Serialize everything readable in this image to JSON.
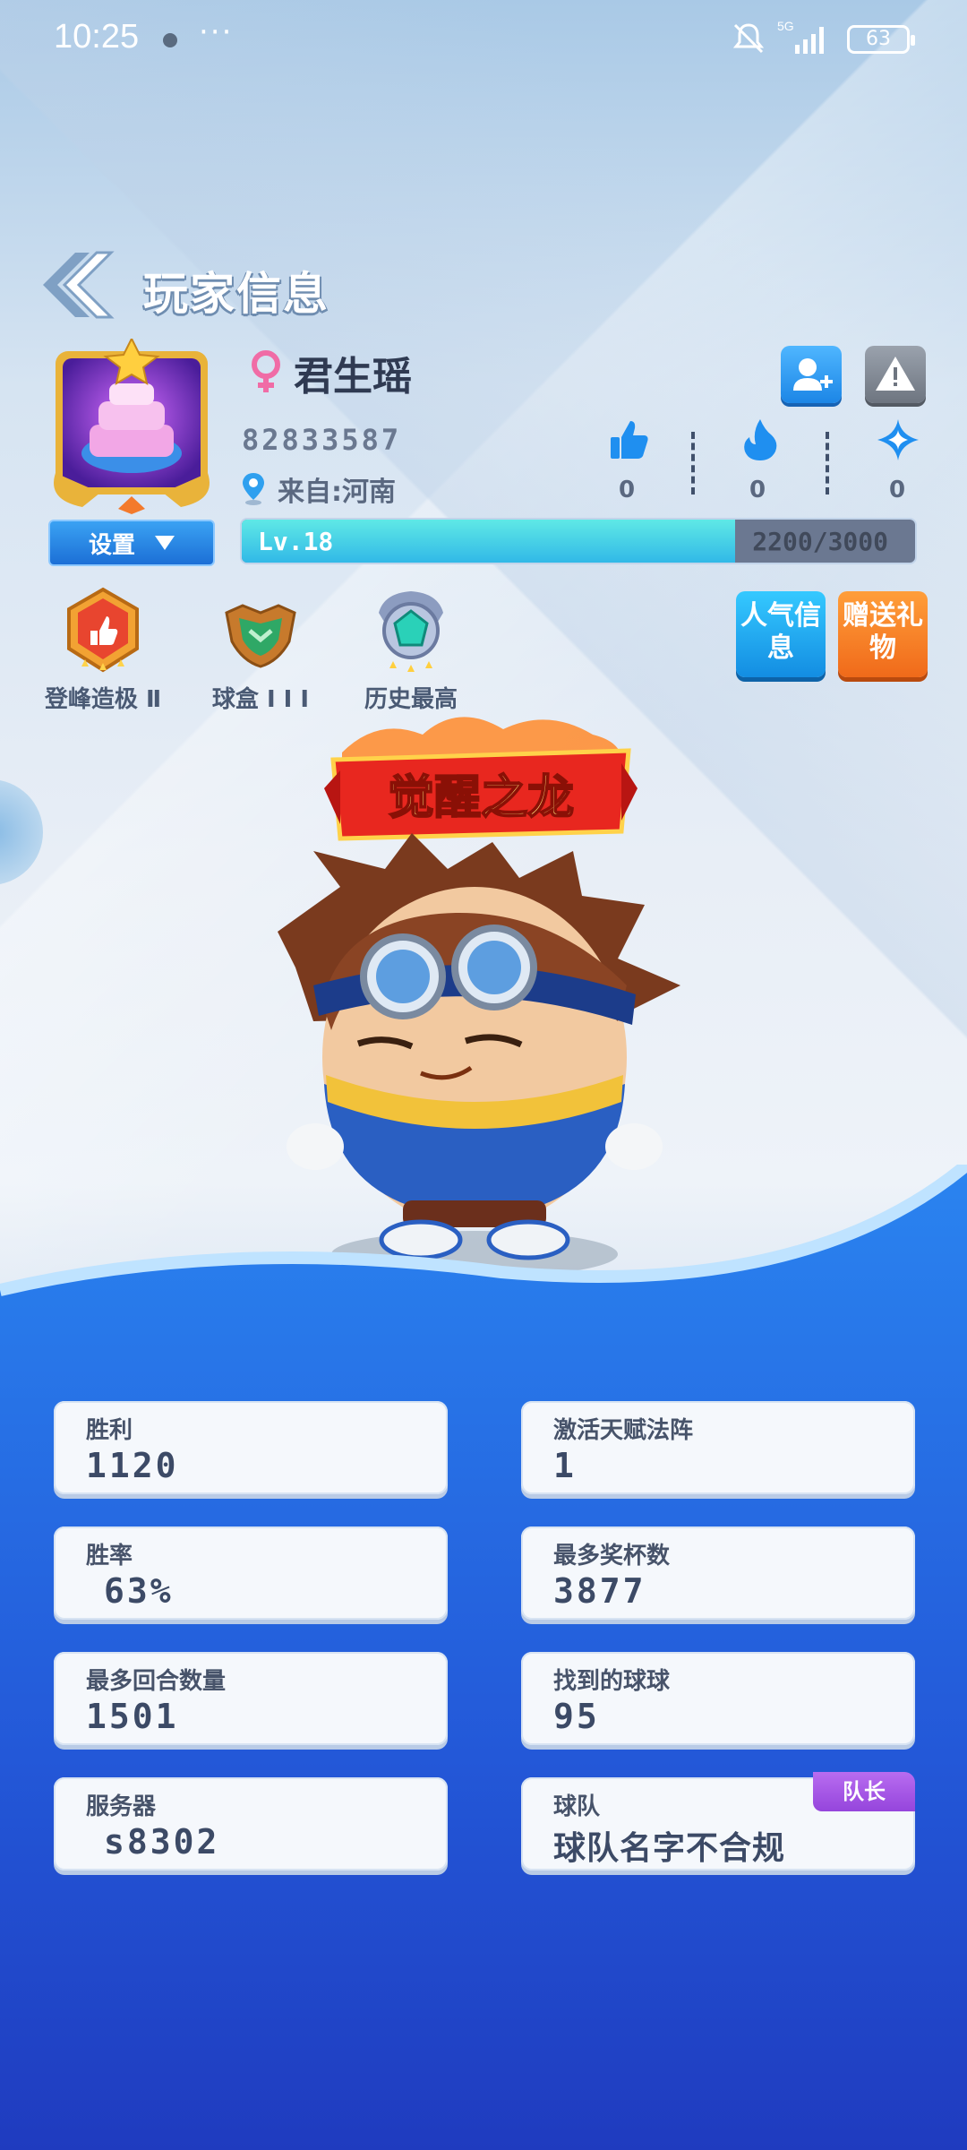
{
  "status_bar": {
    "time": "10:25",
    "more": "···",
    "network": "5G",
    "battery": "63"
  },
  "header": {
    "title": "玩家信息"
  },
  "profile": {
    "name": "君生瑶",
    "id": "82833587",
    "location": "来自:河南",
    "settings_label": "设置",
    "level_label": "Lv.18",
    "exp_text": "2200/3000",
    "exp_progress": 0.733
  },
  "reactions": [
    {
      "icon": "thumbs-up-icon",
      "count": "0"
    },
    {
      "icon": "flame-icon",
      "count": "0"
    },
    {
      "icon": "star-icon",
      "count": "0"
    }
  ],
  "badges": [
    {
      "icon": "peak-rank-badge-icon",
      "label": "登峰造极 Ⅱ"
    },
    {
      "icon": "ball-box-badge-icon",
      "label": "球盒 I I I"
    },
    {
      "icon": "history-best-badge-icon",
      "label": "历史最高"
    }
  ],
  "actions": {
    "popularity": "人气信息",
    "gift": "赠送礼物"
  },
  "title_banner": "觉醒之龙",
  "stats": {
    "wins": {
      "label": "胜利",
      "value": "1120"
    },
    "talent": {
      "label": "激活天赋法阵",
      "value": "1"
    },
    "win_rate": {
      "label": "胜率",
      "value": "63%"
    },
    "trophies": {
      "label": "最多奖杯数",
      "value": "3877"
    },
    "rounds": {
      "label": "最多回合数量",
      "value": "1501"
    },
    "balls": {
      "label": "找到的球球",
      "value": "95"
    },
    "server": {
      "label": "服务器",
      "value": "s8302"
    },
    "team": {
      "label": "球队",
      "value": "球队名字不合规",
      "role": "队长"
    }
  },
  "colors": {
    "accent_blue": "#1f6fe0",
    "gift_orange": "#f06a1a",
    "captain_purple": "#9545dc",
    "exp_cyan": "#31b9e7"
  }
}
